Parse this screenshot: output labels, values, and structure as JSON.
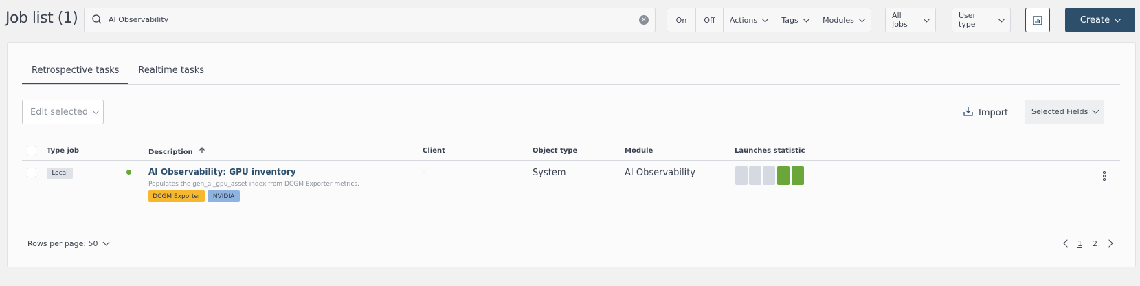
{
  "header": {
    "title": "Job list (1)",
    "search_value": "AI Observability",
    "on_label": "On",
    "off_label": "Off",
    "actions_label": "Actions",
    "tags_label": "Tags",
    "modules_label": "Modules",
    "all_jobs_label": "All Jobs",
    "user_type_label": "User type",
    "create_label": "Create"
  },
  "tabs": [
    {
      "label": "Retrospective tasks",
      "active": true
    },
    {
      "label": "Realtime tasks",
      "active": false
    }
  ],
  "toolbar": {
    "edit_selected_label": "Edit selected",
    "import_label": "Import",
    "selected_fields_label": "Selected Fields"
  },
  "table": {
    "columns": [
      "Type job",
      "Description",
      "Client",
      "Object type",
      "Module",
      "Launches statistic"
    ],
    "rows": [
      {
        "type": "Local",
        "status": "active",
        "title": "AI Observability: GPU inventory",
        "description": "Populates the gen_ai_gpu_asset index from DCGM Exporter metrics.",
        "tags": [
          "DCGM Exporter",
          "NVIDIA"
        ],
        "client": "-",
        "object_type": "System",
        "module": "AI Observability",
        "launches": [
          "none",
          "none",
          "none",
          "success",
          "success"
        ]
      }
    ]
  },
  "footer": {
    "rows_per_page_label": "Rows per page: 50",
    "pages": [
      "1",
      "2"
    ],
    "current_page": "1"
  },
  "colors": {
    "primary": "#2d4f6c",
    "success": "#6aa63a",
    "tag_dcgm": "#f5b82e",
    "tag_nvidia": "#8fb3e0",
    "launch_none": "#d5dae2"
  }
}
